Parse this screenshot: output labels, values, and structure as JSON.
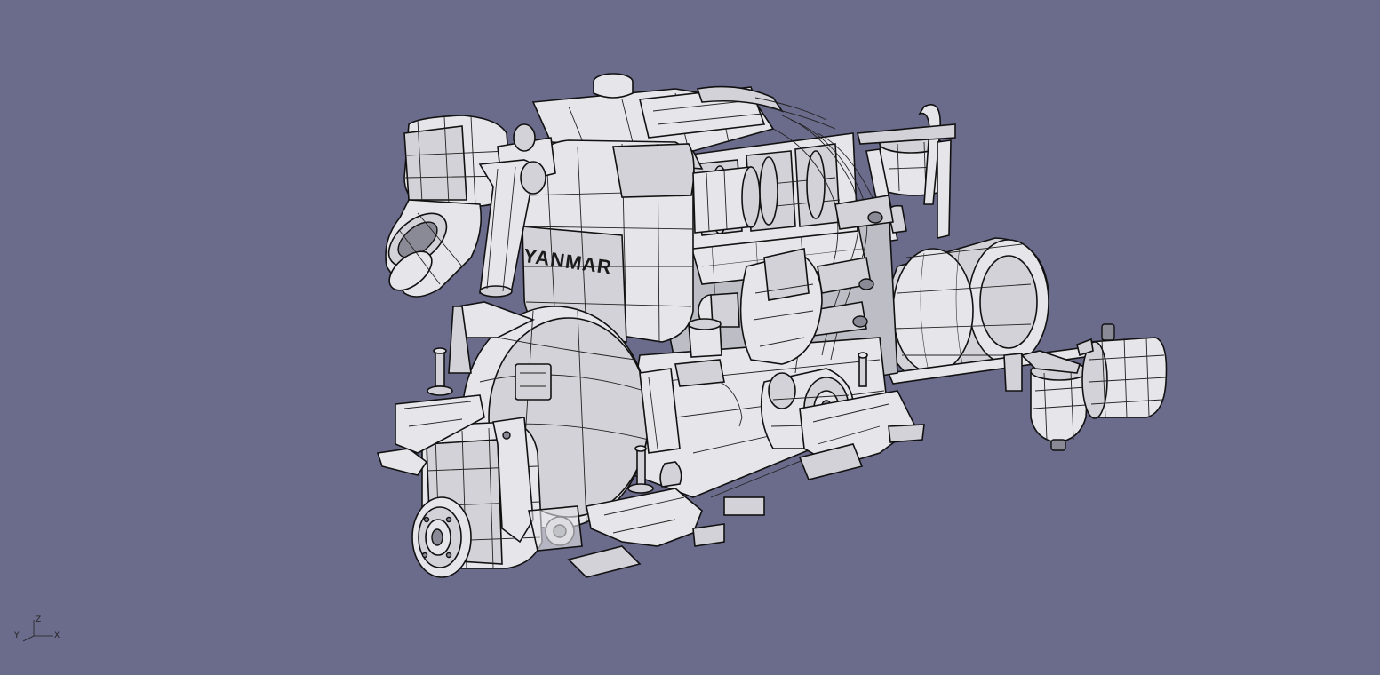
{
  "viewer": {
    "background_color": "#6b6b8c",
    "render_mode": "shaded-with-edges",
    "model": {
      "brand_label": "YANMAR",
      "components": [
        "air-intake-box",
        "exhaust-elbow",
        "valve-cover",
        "flywheel-housing",
        "alternator",
        "engine-mount",
        "heat-exchanger",
        "fuel-filter",
        "coolant-tank",
        "pulley",
        "oil-filter",
        "water-pump"
      ]
    },
    "axis_triad": {
      "x": "X",
      "y": "Y",
      "z": "Z"
    }
  }
}
